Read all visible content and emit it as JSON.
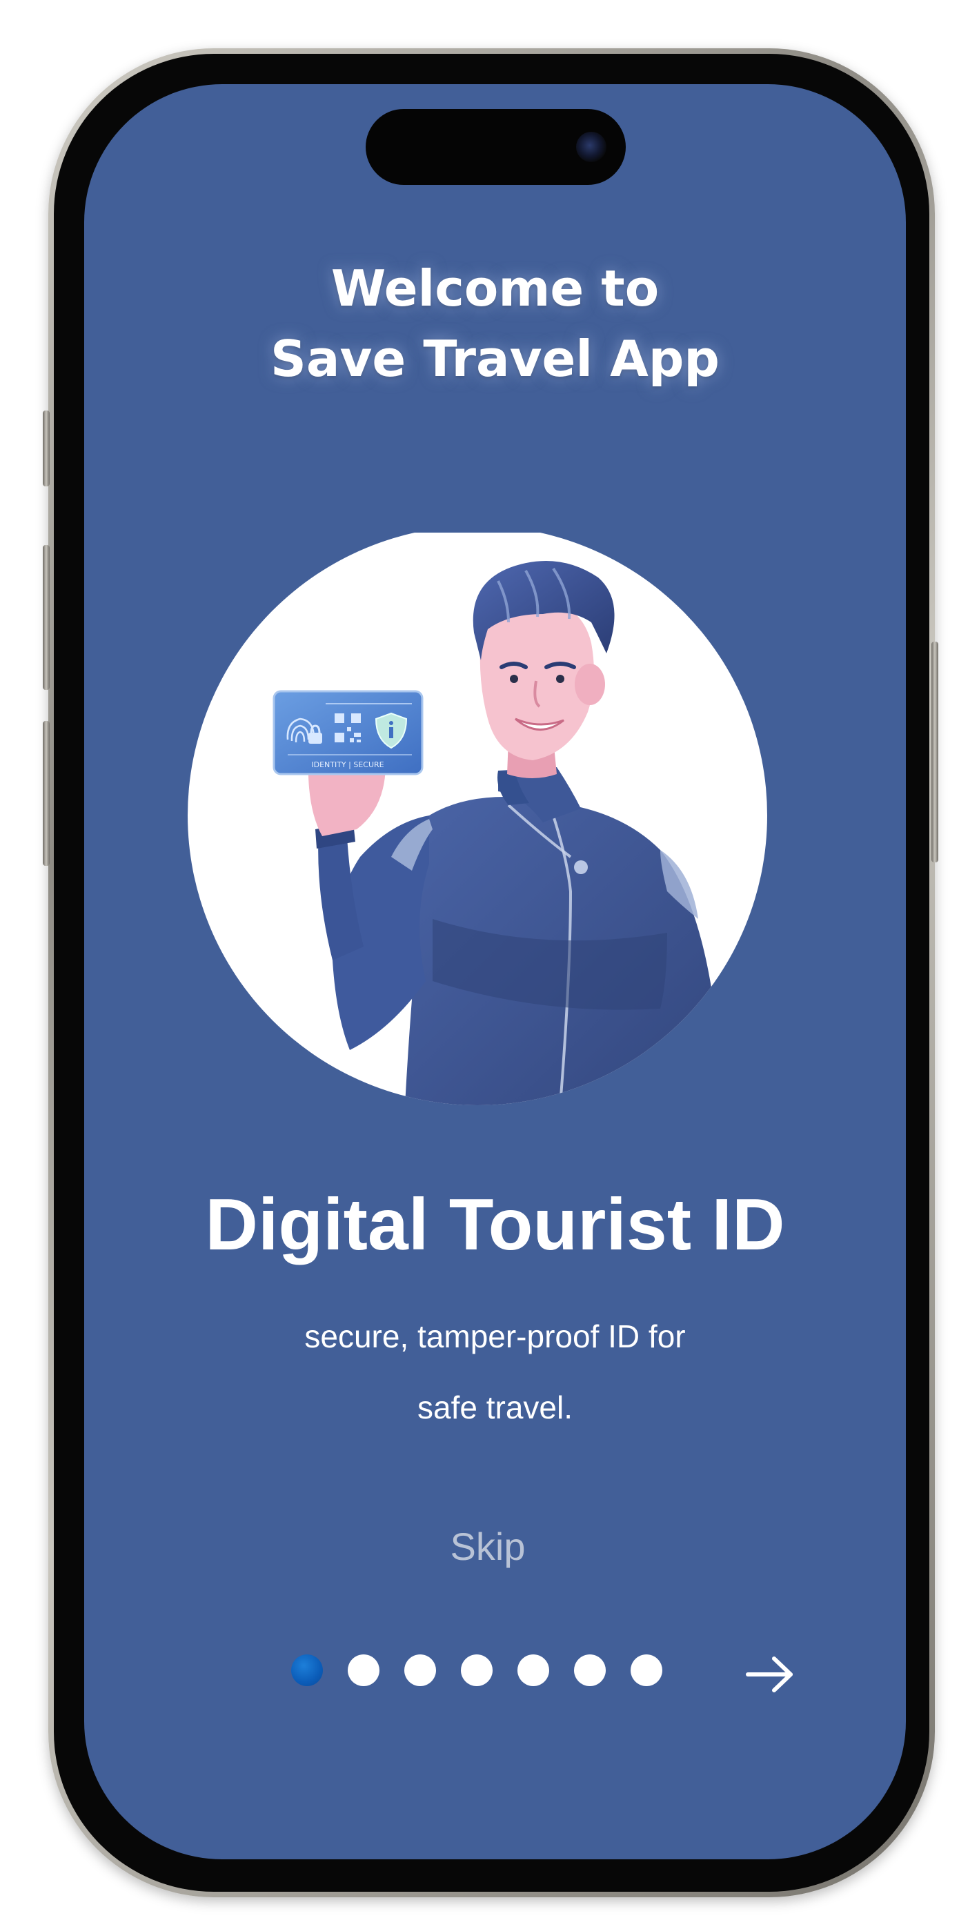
{
  "welcome": {
    "line1": "Welcome to",
    "line2": "Save Travel App"
  },
  "hero": {
    "card_text": "IDENTITY | SECURE"
  },
  "headline": "Digital Tourist ID",
  "subtitle": {
    "line1": "secure, tamper-proof ID for",
    "line2": "safe travel."
  },
  "skip_label": "Skip",
  "pagination": {
    "total": 7,
    "active_index": 0
  },
  "icons": {
    "next": "arrow-right-icon",
    "fingerprint": "fingerprint-icon",
    "lock": "lock-icon",
    "qr": "qr-code-icon",
    "shield": "shield-info-icon"
  },
  "colors": {
    "screen_background": "#425f98",
    "active_dot": "#0b5cb8",
    "inactive_dot": "#ffffff",
    "skip_text": "#b9c3d6",
    "text": "#ffffff"
  }
}
